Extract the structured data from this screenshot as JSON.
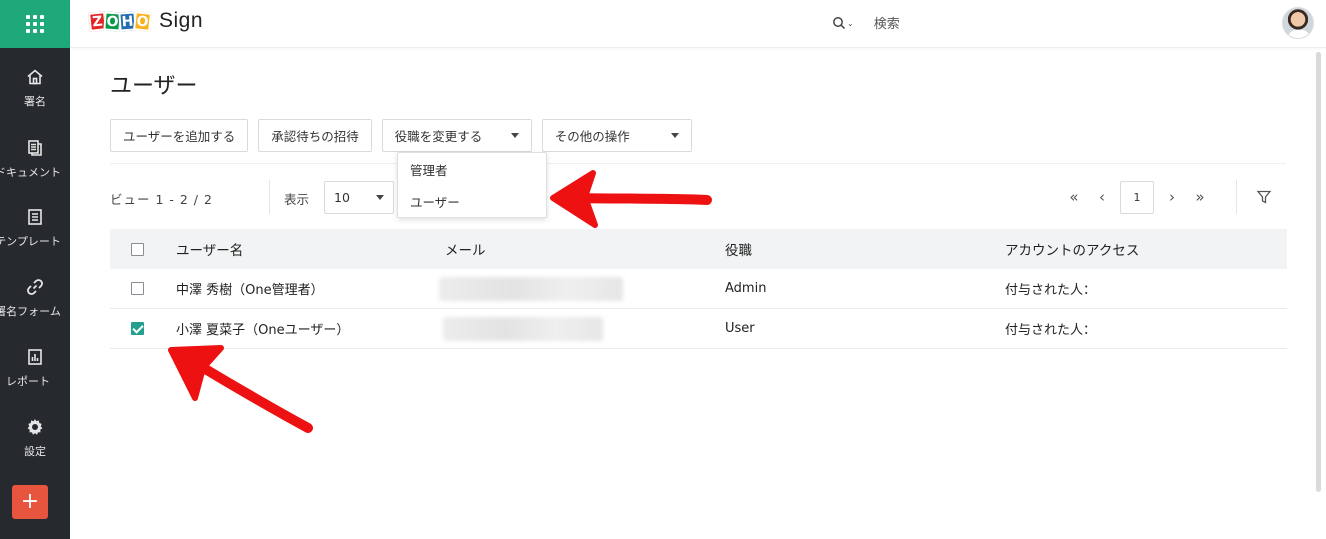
{
  "app": {
    "brand": "ZOHO",
    "name": "Sign"
  },
  "colors": {
    "accent_green": "#1fa97a",
    "sidebar_bg": "#262a2e",
    "add_button": "#e8553e",
    "checkbox_checked": "#25a08f",
    "annotation_red": "#ee1111"
  },
  "sidebar": {
    "items": [
      {
        "label": "署名",
        "icon": "home-icon"
      },
      {
        "label": "ドキュメント",
        "icon": "documents-icon"
      },
      {
        "label": "テンプレート",
        "icon": "templates-icon"
      },
      {
        "label": "署名フォーム",
        "icon": "link-icon"
      },
      {
        "label": "レポート",
        "icon": "reports-icon"
      },
      {
        "label": "設定",
        "icon": "gear-icon"
      }
    ],
    "add_label": "+"
  },
  "header": {
    "search_label": "検索"
  },
  "page": {
    "title": "ユーザー",
    "toolbar": {
      "add_user": "ユーザーを追加する",
      "pending_invites": "承認待ちの招待",
      "change_role": "役職を変更する",
      "other_actions": "その他の操作"
    },
    "role_menu": {
      "options": [
        "管理者",
        "ユーザー"
      ]
    },
    "view_count": "ビュー 1 - 2 / 2",
    "show_label": "表示",
    "per_page": "10",
    "pager": {
      "first": "«",
      "prev": "‹",
      "current": "1",
      "next": "›",
      "last": "»"
    },
    "table": {
      "headers": {
        "name": "ユーザー名",
        "mail": "メール",
        "role": "役職",
        "access": "アカウントのアクセス"
      },
      "rows": [
        {
          "name": "中澤 秀樹（One管理者）",
          "role": "Admin",
          "access": "付与された人：",
          "checked": false
        },
        {
          "name": "小澤 夏菜子（Oneユーザー）",
          "role": "User",
          "access": "付与された人：",
          "checked": true
        }
      ]
    }
  }
}
